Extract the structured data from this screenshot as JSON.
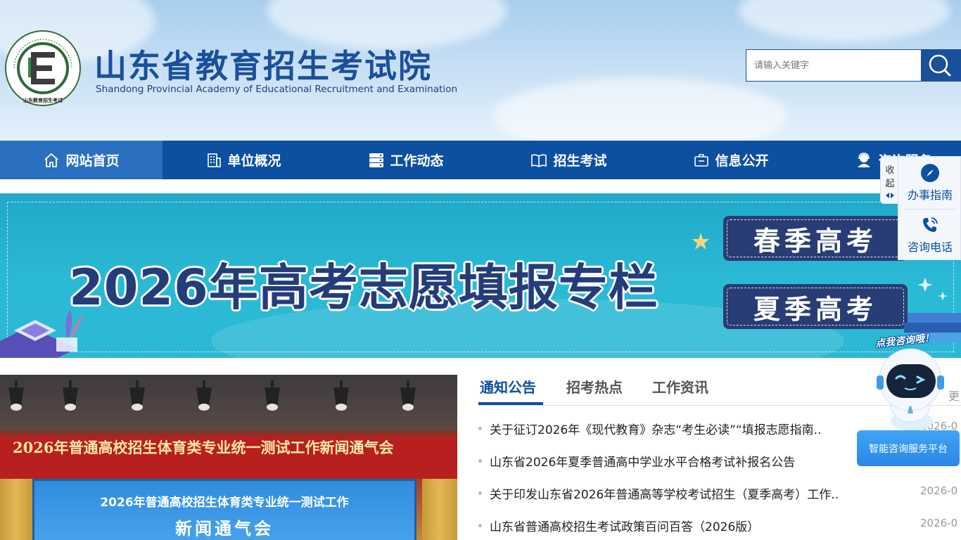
{
  "header": {
    "title": "山东省教育招生考试院",
    "subtitle": "Shandong Provincial Academy of Educational Recruitment and Examination",
    "emblem_ring_text": "Shandong Educational Admission & Examination",
    "emblem_bottom_text": "山东教育招生考试",
    "emblem_letter": "E"
  },
  "search": {
    "placeholder": "请输入关键字"
  },
  "nav": {
    "items": [
      {
        "label": "网站首页",
        "icon": "home-icon",
        "active": true
      },
      {
        "label": "单位概况",
        "icon": "building-icon"
      },
      {
        "label": "工作动态",
        "icon": "server-icon"
      },
      {
        "label": "招生考试",
        "icon": "book-icon"
      },
      {
        "label": "信息公开",
        "icon": "briefcase-icon"
      },
      {
        "label": "咨询服务",
        "icon": "headset-icon"
      }
    ]
  },
  "banner": {
    "title": "2026年高考志愿填报专栏",
    "buttons": [
      {
        "label": "春季高考"
      },
      {
        "label": "夏季高考"
      }
    ]
  },
  "photo": {
    "backdrop_text": "2026年普通高校招生体育类专业统一测试工作新闻通气会",
    "screen_line1": "2026年普通高校招生体育类专业统一测试工作",
    "screen_line2": "新闻通气会"
  },
  "news": {
    "tabs": [
      {
        "label": "通知公告",
        "active": true
      },
      {
        "label": "招考热点"
      },
      {
        "label": "工作资讯"
      }
    ],
    "more_label": "更",
    "items": [
      {
        "title": "关于征订2026年《现代教育》杂志“考生必读”“填报志愿指南..",
        "date": "2026-0"
      },
      {
        "title": "山东省2026年夏季普通高中学业水平合格考试补报名公告",
        "date": ""
      },
      {
        "title": "关于印发山东省2026年普通高等学校考试招生（夏季高考）工作..",
        "date": "2026-0"
      },
      {
        "title": "山东省普通高校招生考试政策百问百答（2026版）",
        "date": "2026-0"
      }
    ]
  },
  "side_panel": {
    "collapse_label": [
      "收",
      "起"
    ],
    "items": [
      {
        "label": "办事指南",
        "icon": "compass-icon"
      },
      {
        "label": "咨询电话",
        "icon": "phone-icon"
      }
    ]
  },
  "assistant": {
    "hint": "点我咨询哦！",
    "button_label": "智能咨询服务平台"
  },
  "colors": {
    "brand": "#0d4fa0",
    "banner_bg": "#2bbad6",
    "exam_button": "#283d75"
  }
}
